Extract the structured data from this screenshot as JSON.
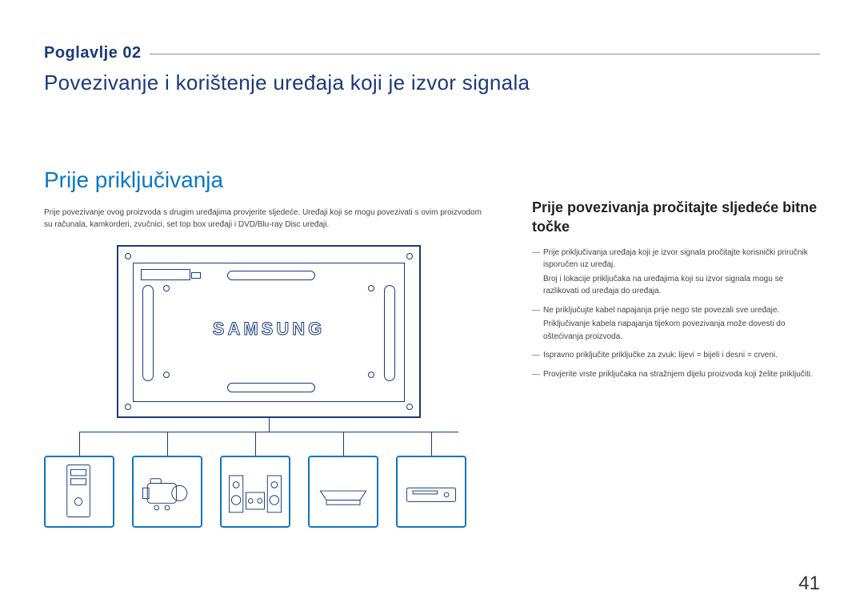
{
  "chapter_label": "Poglavlje 02",
  "chapter_title": "Povezivanje i korištenje uređaja koji je izvor signala",
  "section_title": "Prije priključivanja",
  "intro": "Prije povezivanje ovog proizvoda s drugim uređajima provjerite sljedeće. Uređaji koji se mogu povezivati s ovim proizvodom su računala, kamkorderi, zvučnici, set top box uređaji i DVD/Blu-ray Disc uređaji.",
  "right": {
    "heading": "Prije povezivanja pročitajte sljedeće bitne točke",
    "bullets": [
      {
        "main": "Prije priključivanja uređaja koji je izvor signala pročitajte korisnički priručnik isporučen uz uređaj.",
        "sub": "Broj i lokacije priključaka na uređajima koji su izvor signala mogu se razlikovati od uređaja do uređaja."
      },
      {
        "main": "Ne priključujte kabel napajanja prije nego ste povezali sve uređaje.",
        "sub": "Priključivanje kabela napajanja tijekom povezivanja može dovesti do oštećivanja proizvoda."
      },
      {
        "main": "Ispravno priključite priključke za zvuk: lijevi = bijeli i desni = crveni.",
        "sub": ""
      },
      {
        "main": "Provjerite vrste priključaka na stražnjem dijelu proizvoda koji želite priključiti.",
        "sub": ""
      }
    ]
  },
  "brand": "SAMSUNG",
  "page_number": "41"
}
